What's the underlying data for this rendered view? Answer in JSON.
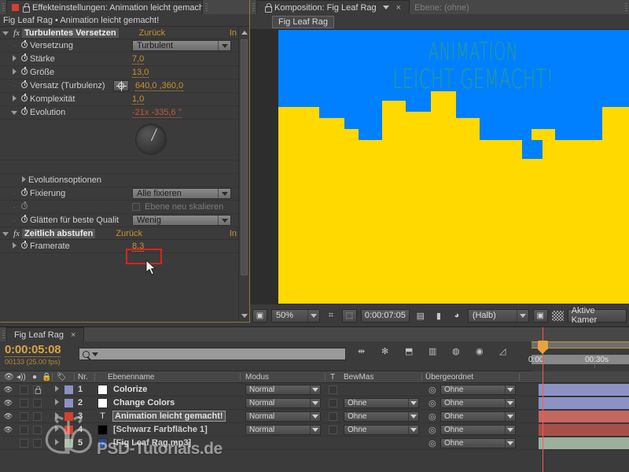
{
  "effects_panel": {
    "tab_label": "Effekteinstellungen: Animation leicht gemacht",
    "subtitle": "Fig Leaf Rag • Animation leicht gemacht!",
    "lock_icon": "lock-icon",
    "menu_icon": "panel-menu-icon",
    "groups": [
      {
        "name": "Turbulentes Versetzen",
        "reset_label": "Zurück",
        "about_label": "In",
        "fx_badge": "fx",
        "properties": [
          {
            "label": "Versetzung",
            "type": "dropdown",
            "value": "Turbulent",
            "twirl": "none"
          },
          {
            "label": "Stärke",
            "type": "number",
            "value": "7,0",
            "twirl": "right"
          },
          {
            "label": "Größe",
            "type": "number",
            "value": "13,0",
            "twirl": "right"
          },
          {
            "label": "Versatz (Turbulenz)",
            "type": "point",
            "value": "640,0 ,360,0",
            "twirl": "none"
          },
          {
            "label": "Komplexität",
            "type": "number",
            "value": "1,0",
            "twirl": "right"
          },
          {
            "label": "Evolution",
            "type": "angle",
            "value": "-21x -335,6 °",
            "twirl": "down"
          }
        ],
        "sub_header": "Evolutionsoptionen",
        "sub_properties": [
          {
            "label": "Fixierung",
            "type": "dropdown",
            "value": "Alle fixieren",
            "twirl": "none"
          },
          {
            "label": "",
            "type": "checkbox",
            "value": "Ebene neu skalieren",
            "disabled": true,
            "twirl": "none"
          },
          {
            "label": "Glätten für beste Qualit",
            "type": "dropdown",
            "value": "Wenig",
            "twirl": "none"
          }
        ]
      },
      {
        "name": "Zeitlich abstufen",
        "reset_label": "Zurück",
        "about_label": "In",
        "fx_badge": "fx",
        "properties": [
          {
            "label": "Framerate",
            "type": "number",
            "value": "8,3",
            "twirl": "right",
            "highlighted": true
          }
        ]
      }
    ],
    "highlight_color": "#e02020"
  },
  "comp_panel": {
    "tabs": [
      {
        "label": "Komposition: Fig Leaf Rag",
        "active": true,
        "swatch_color": "#b3a57d"
      },
      {
        "label": "Ebene: (ohne)",
        "active": false
      }
    ],
    "close_icon": "close-icon",
    "comp_name_button": "Fig Leaf Rag",
    "artwork": {
      "sky_color": "#0080ff",
      "ground_color": "#ffd900",
      "text_color": "#2c9c87",
      "line1": "ANIMATION",
      "line2": "LEICHT GEMACHT!"
    },
    "bottom_bar": {
      "zoom": "50%",
      "timecode": "0:00:07:05",
      "resolution": "(Halb)",
      "camera": "Aktive Kamer",
      "icons": [
        "region-of-interest-icon",
        "grid-icon",
        "mask-icon",
        "snapshot-icon",
        "show-snapshot-icon",
        "channel-icon",
        "transparency-grid-icon",
        "alpha-checker-icon"
      ]
    }
  },
  "timeline": {
    "tab_label": "Fig Leaf Rag",
    "close_icon": "close-icon",
    "timecode": "0:00:05:08",
    "frame_info": "00133 (25.00 fps)",
    "search_icon": "search-icon",
    "search_value": "",
    "switch_icons": [
      "live-update-icon",
      "draft-3d-icon",
      "hide-shy-icon",
      "frame-blending-icon",
      "motion-blur-icon",
      "brainstorm-icon",
      "graph-editor-icon"
    ],
    "ruler_labels": [
      "0:00",
      "00:30s"
    ],
    "columns": [
      "eye-col",
      "audio-col",
      "solo-col",
      "lock-col",
      "label-col",
      "Nr.",
      "Ebenenname",
      "Modus",
      "T",
      "BewMas",
      "Übergeordnet"
    ],
    "column_headers": {
      "number": "Nr.",
      "layer_name": "Ebenenname",
      "mode": "Modus",
      "track_matte_t": "T",
      "track_matte": "BewMas",
      "parent": "Übergeordnet"
    },
    "layers": [
      {
        "num": "1",
        "name": "Colorize",
        "label_color": "#8c92c4",
        "thumb": "#ffffff",
        "mode": "Normal",
        "matte": "",
        "parent": "Ohne",
        "locked": true,
        "selected": false,
        "bar_color": "#8c92c4",
        "type": "adjustment"
      },
      {
        "num": "2",
        "name": "Change Colors",
        "label_color": "#8c92c4",
        "thumb": "#ffffff",
        "mode": "Normal",
        "matte": "Ohne",
        "parent": "Ohne",
        "locked": false,
        "selected": false,
        "bar_color": "#8c92c4",
        "type": "adjustment"
      },
      {
        "num": "3",
        "name": "Animation leicht gemacht!",
        "label_color": "#d4402e",
        "thumb": "T",
        "mode": "Normal",
        "matte": "Ohne",
        "parent": "Ohne",
        "locked": false,
        "selected": true,
        "bar_color": "#c4675e",
        "type": "text"
      },
      {
        "num": "4",
        "name": "[Schwarz Farbfläche 1]",
        "label_color": "#d4402e",
        "thumb": "#000000",
        "mode": "Normal",
        "matte": "Ohne",
        "parent": "Ohne",
        "locked": false,
        "selected": false,
        "bar_color": "#a85048",
        "type": "solid"
      },
      {
        "num": "5",
        "name": "[Fig Leaf Rag.mp3]",
        "label_color": "#8aa88a",
        "thumb": "audio",
        "mode": "",
        "matte": "",
        "parent": "Ohne",
        "locked": false,
        "selected": false,
        "bar_color": "#9cb09c",
        "type": "audio"
      }
    ]
  },
  "watermark": {
    "text": "PSD-Tutorials.de",
    "logo": "butterfly-logo"
  },
  "cursor": {
    "icon": "arrow-cursor"
  }
}
